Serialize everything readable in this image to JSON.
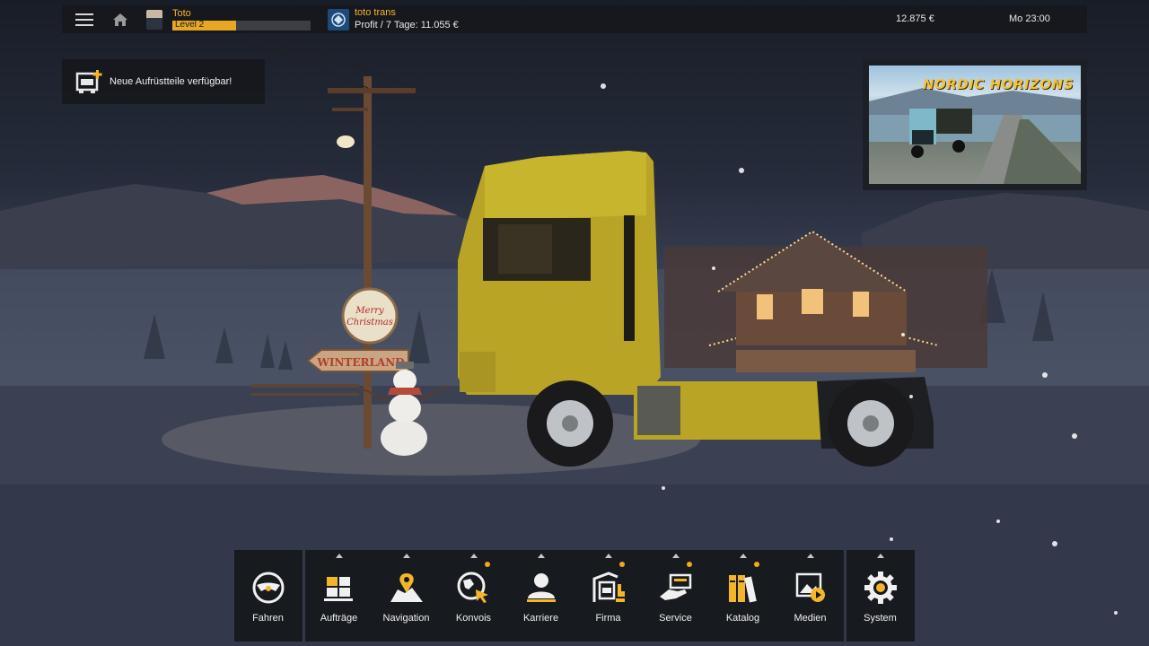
{
  "topbar": {
    "player_name": "Toto",
    "level_label": "Level 2",
    "level_progress_fraction": 0.46,
    "company_name": "toto trans",
    "company_profit": "Profit / 7 Tage: 11.055 €",
    "money": "12.875 €",
    "time": "Mo 23:00"
  },
  "notification": {
    "text": "Neue Aufrüstteile verfügbar!",
    "icon": "truck-upgrade-icon"
  },
  "promo": {
    "title": "NORDIC HORIZONS"
  },
  "scene": {
    "sign_christmas": "Merry Christmas",
    "sign_winterland": "WINTERLAND"
  },
  "dock": {
    "items": [
      {
        "label": "Fahren",
        "icon": "steering-wheel-icon",
        "caret": false,
        "dot": false
      },
      {
        "label": "Aufträge",
        "icon": "cargo-pallet-icon",
        "caret": true,
        "dot": false
      },
      {
        "label": "Navigation",
        "icon": "map-pin-icon",
        "caret": true,
        "dot": false
      },
      {
        "label": "Konvois",
        "icon": "globe-cursor-icon",
        "caret": true,
        "dot": true
      },
      {
        "label": "Karriere",
        "icon": "person-icon",
        "caret": true,
        "dot": false
      },
      {
        "label": "Firma",
        "icon": "garage-truck-icon",
        "caret": true,
        "dot": true
      },
      {
        "label": "Service",
        "icon": "service-hand-icon",
        "caret": true,
        "dot": true
      },
      {
        "label": "Katalog",
        "icon": "books-icon",
        "caret": true,
        "dot": true
      },
      {
        "label": "Medien",
        "icon": "media-gallery-icon",
        "caret": true,
        "dot": false
      },
      {
        "label": "System",
        "icon": "gear-icon",
        "caret": true,
        "dot": false
      }
    ]
  },
  "colors": {
    "accent": "#f5b52a",
    "panel": "#16181c",
    "notification_dot": "#f5a623"
  }
}
